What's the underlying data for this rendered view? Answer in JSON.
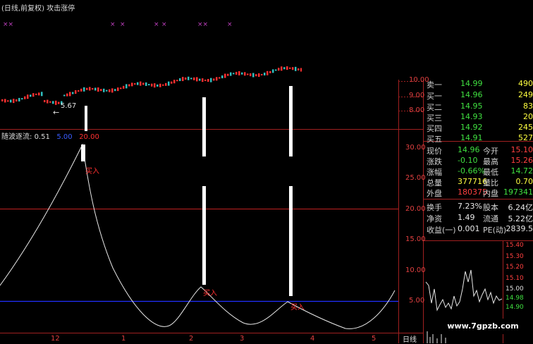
{
  "header": {
    "title": "(日线,前复权) 攻击涨停"
  },
  "indicator": {
    "name": "随波逐流:",
    "v0": "0.51",
    "v1": "5.00",
    "v2": "20.00"
  },
  "price_axis": [
    "10.00",
    "9.00",
    "8.00"
  ],
  "ind_axis": [
    "30.00",
    "25.00",
    "20.00",
    "15.00",
    "10.00",
    "5.00"
  ],
  "low_price_label": "5.67",
  "signal_label": "买入",
  "date_labels": [
    "12",
    "1",
    "2",
    "3",
    "4",
    "5"
  ],
  "timeframe": "日线",
  "order_book": {
    "asks": [
      {
        "label": "卖一",
        "price": "14.99",
        "vol": "490"
      },
      {
        "label": "买一",
        "price": "14.96",
        "vol": "249"
      },
      {
        "label": "买二",
        "price": "14.95",
        "vol": "83"
      },
      {
        "label": "买三",
        "price": "14.93",
        "vol": "20"
      },
      {
        "label": "买四",
        "price": "14.92",
        "vol": "245"
      },
      {
        "label": "买五",
        "price": "14.91",
        "vol": "527"
      }
    ],
    "stats": [
      {
        "l1": "现价",
        "v1": "14.96",
        "l2": "今开",
        "v2": "15.10"
      },
      {
        "l1": "涨跌",
        "v1": "-0.10",
        "l2": "最高",
        "v2": "15.26"
      },
      {
        "l1": "涨幅",
        "v1": "-0.66%",
        "l2": "最低",
        "v2": "14.72"
      },
      {
        "l1": "总量",
        "v1": "377716",
        "l2": "量比",
        "v2": "0.70"
      },
      {
        "l1": "外盘",
        "v1": "180375",
        "l2": "内盘",
        "v2": "197341"
      }
    ],
    "fund": [
      {
        "l1": "换手",
        "v1": "7.23%",
        "l2": "股本",
        "v2": "6.24亿"
      },
      {
        "l1": "净资",
        "v1": "1.49",
        "l2": "流通",
        "v2": "5.22亿"
      },
      {
        "l1": "收益(一)",
        "v1": "0.001",
        "l2": "PE(动)",
        "v2": "2839.5"
      }
    ]
  },
  "mini_axis": [
    "15.40",
    "15.30",
    "15.20",
    "15.10",
    "15.00",
    "14.98",
    "14.90"
  ],
  "watermark": "www.7gpzb.com"
}
